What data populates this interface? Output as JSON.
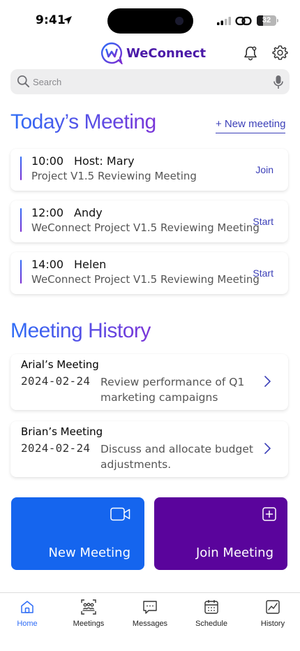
{
  "status_bar": {
    "time": "9:41",
    "battery": "32",
    "battery_level": 0.32
  },
  "header": {
    "app_name": "WeConnect"
  },
  "search": {
    "placeholder": "Search"
  },
  "today": {
    "title": "Today’s Meeting",
    "new_meeting_link": "+ New meeting",
    "meetings": [
      {
        "time": "10:00",
        "host": "Host: Mary",
        "description": "Project V1.5 Reviewing Meeting",
        "action": "Join"
      },
      {
        "time": "12:00",
        "host": "Andy",
        "description": "WeConnect Project V1.5 Reviewing Meeting",
        "action": "Start"
      },
      {
        "time": "14:00",
        "host": "Helen",
        "description": "WeConnect Project V1.5 Reviewing Meeting",
        "action": "Start"
      }
    ]
  },
  "history": {
    "title": "Meeting History",
    "items": [
      {
        "title": "Arial’s Meeting",
        "date": "2024-02-24",
        "description": "Review performance of Q1 marketing campaigns"
      },
      {
        "title": "Brian’s Meeting",
        "date": "2024-02-24",
        "description": "Discuss and allocate budget adjustments."
      }
    ]
  },
  "actions": {
    "new_meeting": "New Meeting",
    "join_meeting": "Join Meeting"
  },
  "tabbar": {
    "items": [
      {
        "label": "Home",
        "icon": "home-icon",
        "active": true
      },
      {
        "label": "Meetings",
        "icon": "meetings-icon",
        "active": false
      },
      {
        "label": "Messages",
        "icon": "messages-icon",
        "active": false
      },
      {
        "label": "Schedule",
        "icon": "schedule-icon",
        "active": false
      },
      {
        "label": "History",
        "icon": "history-icon",
        "active": false
      }
    ]
  },
  "colors": {
    "accent_blue": "#2f6df6",
    "accent_purple": "#5a049c",
    "link": "#3b3fb8",
    "new_meeting_button": "#1565ee"
  }
}
